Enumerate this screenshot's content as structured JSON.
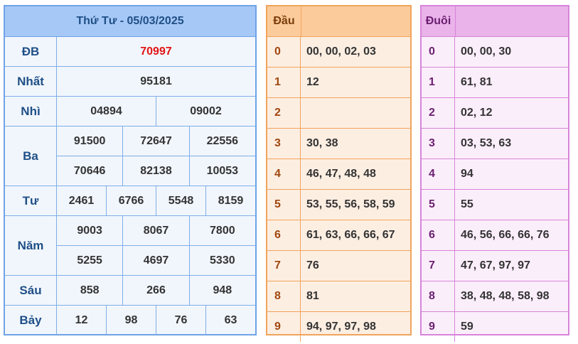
{
  "results": {
    "title": "Thứ Tư - 05/03/2025",
    "prizes": [
      {
        "label": "ĐB",
        "rows": [
          [
            "70997"
          ]
        ]
      },
      {
        "label": "Nhất",
        "rows": [
          [
            "95181"
          ]
        ]
      },
      {
        "label": "Nhì",
        "rows": [
          [
            "04894",
            "09002"
          ]
        ]
      },
      {
        "label": "Ba",
        "rows": [
          [
            "91500",
            "72647",
            "22556"
          ],
          [
            "70646",
            "82138",
            "10053"
          ]
        ]
      },
      {
        "label": "Tư",
        "rows": [
          [
            "2461",
            "6766",
            "5548",
            "8159"
          ]
        ]
      },
      {
        "label": "Năm",
        "rows": [
          [
            "9003",
            "8067",
            "7800"
          ],
          [
            "5255",
            "4697",
            "5330"
          ]
        ]
      },
      {
        "label": "Sáu",
        "rows": [
          [
            "858",
            "266",
            "948"
          ]
        ]
      },
      {
        "label": "Bảy",
        "rows": [
          [
            "12",
            "98",
            "76",
            "63"
          ]
        ]
      }
    ]
  },
  "dau": {
    "title": "Đầu",
    "rows": [
      {
        "k": "0",
        "v": "00, 00, 02, 03"
      },
      {
        "k": "1",
        "v": "12"
      },
      {
        "k": "2",
        "v": ""
      },
      {
        "k": "3",
        "v": "30, 38"
      },
      {
        "k": "4",
        "v": "46, 47, 48, 48"
      },
      {
        "k": "5",
        "v": "53, 55, 56, 58, 59"
      },
      {
        "k": "6",
        "v": "61, 63, 66, 66, 67"
      },
      {
        "k": "7",
        "v": "76"
      },
      {
        "k": "8",
        "v": "81"
      },
      {
        "k": "9",
        "v": "94, 97, 97, 98"
      }
    ]
  },
  "duoi": {
    "title": "Đuôi",
    "rows": [
      {
        "k": "0",
        "v": "00, 00, 30"
      },
      {
        "k": "1",
        "v": "61, 81"
      },
      {
        "k": "2",
        "v": "02, 12"
      },
      {
        "k": "3",
        "v": "03, 53, 63"
      },
      {
        "k": "4",
        "v": "94"
      },
      {
        "k": "5",
        "v": "55"
      },
      {
        "k": "6",
        "v": "46, 56, 66, 66, 76"
      },
      {
        "k": "7",
        "v": "47, 67, 97, 97"
      },
      {
        "k": "8",
        "v": "38, 48, 48, 58, 98"
      },
      {
        "k": "9",
        "v": "59"
      }
    ]
  }
}
